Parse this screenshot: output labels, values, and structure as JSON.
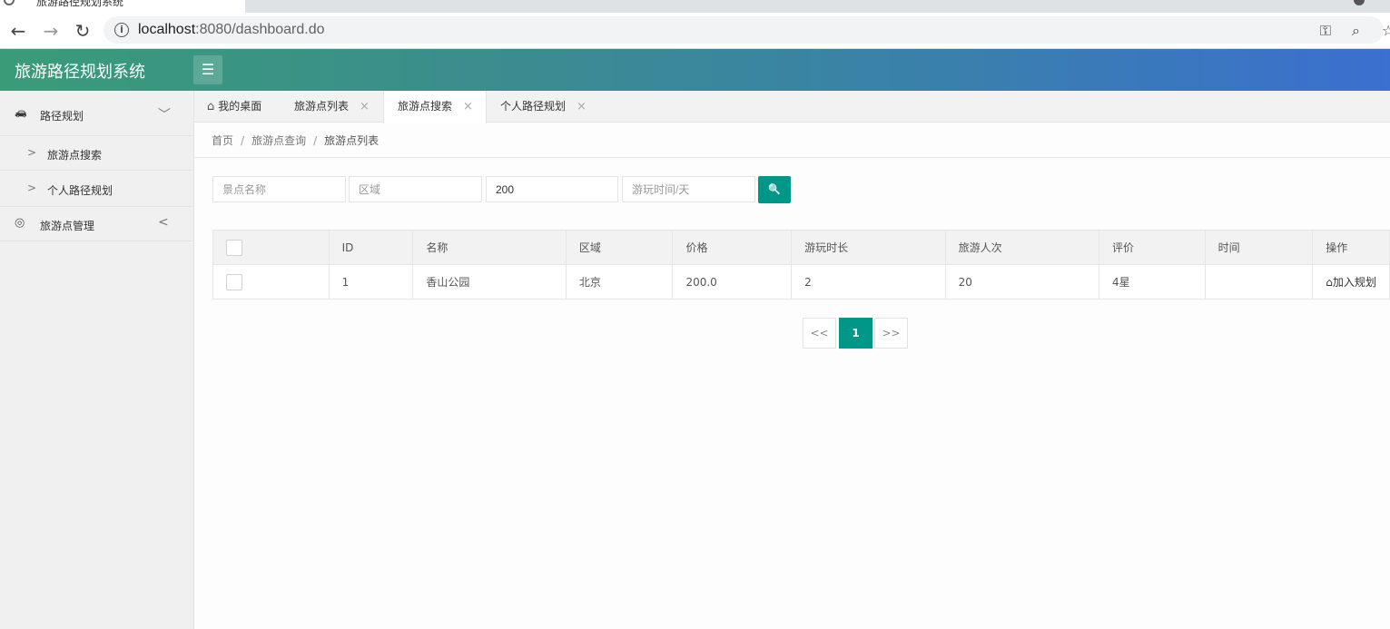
{
  "browser": {
    "tab_title": "旅游路径规划系统",
    "url_host": "localhost",
    "url_rest": ":8080/dashboard.do",
    "back_glyph": "←",
    "forward_glyph": "→",
    "reload_glyph": "↻",
    "info_glyph": "i",
    "key_glyph": "⚿",
    "zoom_glyph": "⌕",
    "star_glyph": "☆"
  },
  "header": {
    "title": "旅游路径规划系统",
    "menu_glyph": "☰",
    "accent_color": "#009688"
  },
  "sidebar": {
    "groups": [
      {
        "label": "路径规划",
        "icon": "car-icon",
        "icon_glyph": "🚗",
        "chevron": "﹀",
        "items": [
          {
            "label": "旅游点搜索",
            "chev": ">"
          },
          {
            "label": "个人路径规划",
            "chev": ">"
          }
        ]
      },
      {
        "label": "旅游点管理",
        "icon": "compass-icon",
        "icon_glyph": "◎",
        "chevron": "<"
      }
    ]
  },
  "tabs": [
    {
      "label": "我的桌面",
      "home_glyph": "⌂"
    },
    {
      "label": "旅游点列表",
      "close": "×"
    },
    {
      "label": "旅游点搜索",
      "close": "×"
    },
    {
      "label": "个人路径规划",
      "close": "×"
    }
  ],
  "breadcrumb": {
    "items": [
      "首页",
      "旅游点查询",
      "旅游点列表"
    ],
    "sep": "/"
  },
  "search": {
    "name_placeholder": "景点名称",
    "region_placeholder": "区域",
    "price_value": "200",
    "duration_placeholder": "游玩时间/天",
    "button_glyph": "🔍"
  },
  "table": {
    "headers": [
      "ID",
      "名称",
      "区域",
      "价格",
      "游玩时长",
      "旅游人次",
      "评价",
      "时间",
      "操作"
    ],
    "rows": [
      {
        "id": "1",
        "name": "香山公园",
        "region": "北京",
        "price": "200.0",
        "duration": "2",
        "visits": "20",
        "rating": "4星",
        "time": "",
        "action": "加入规划",
        "action_glyph": "⌂"
      }
    ]
  },
  "pagination": {
    "prev": "<<",
    "current": "1",
    "next": ">>"
  }
}
